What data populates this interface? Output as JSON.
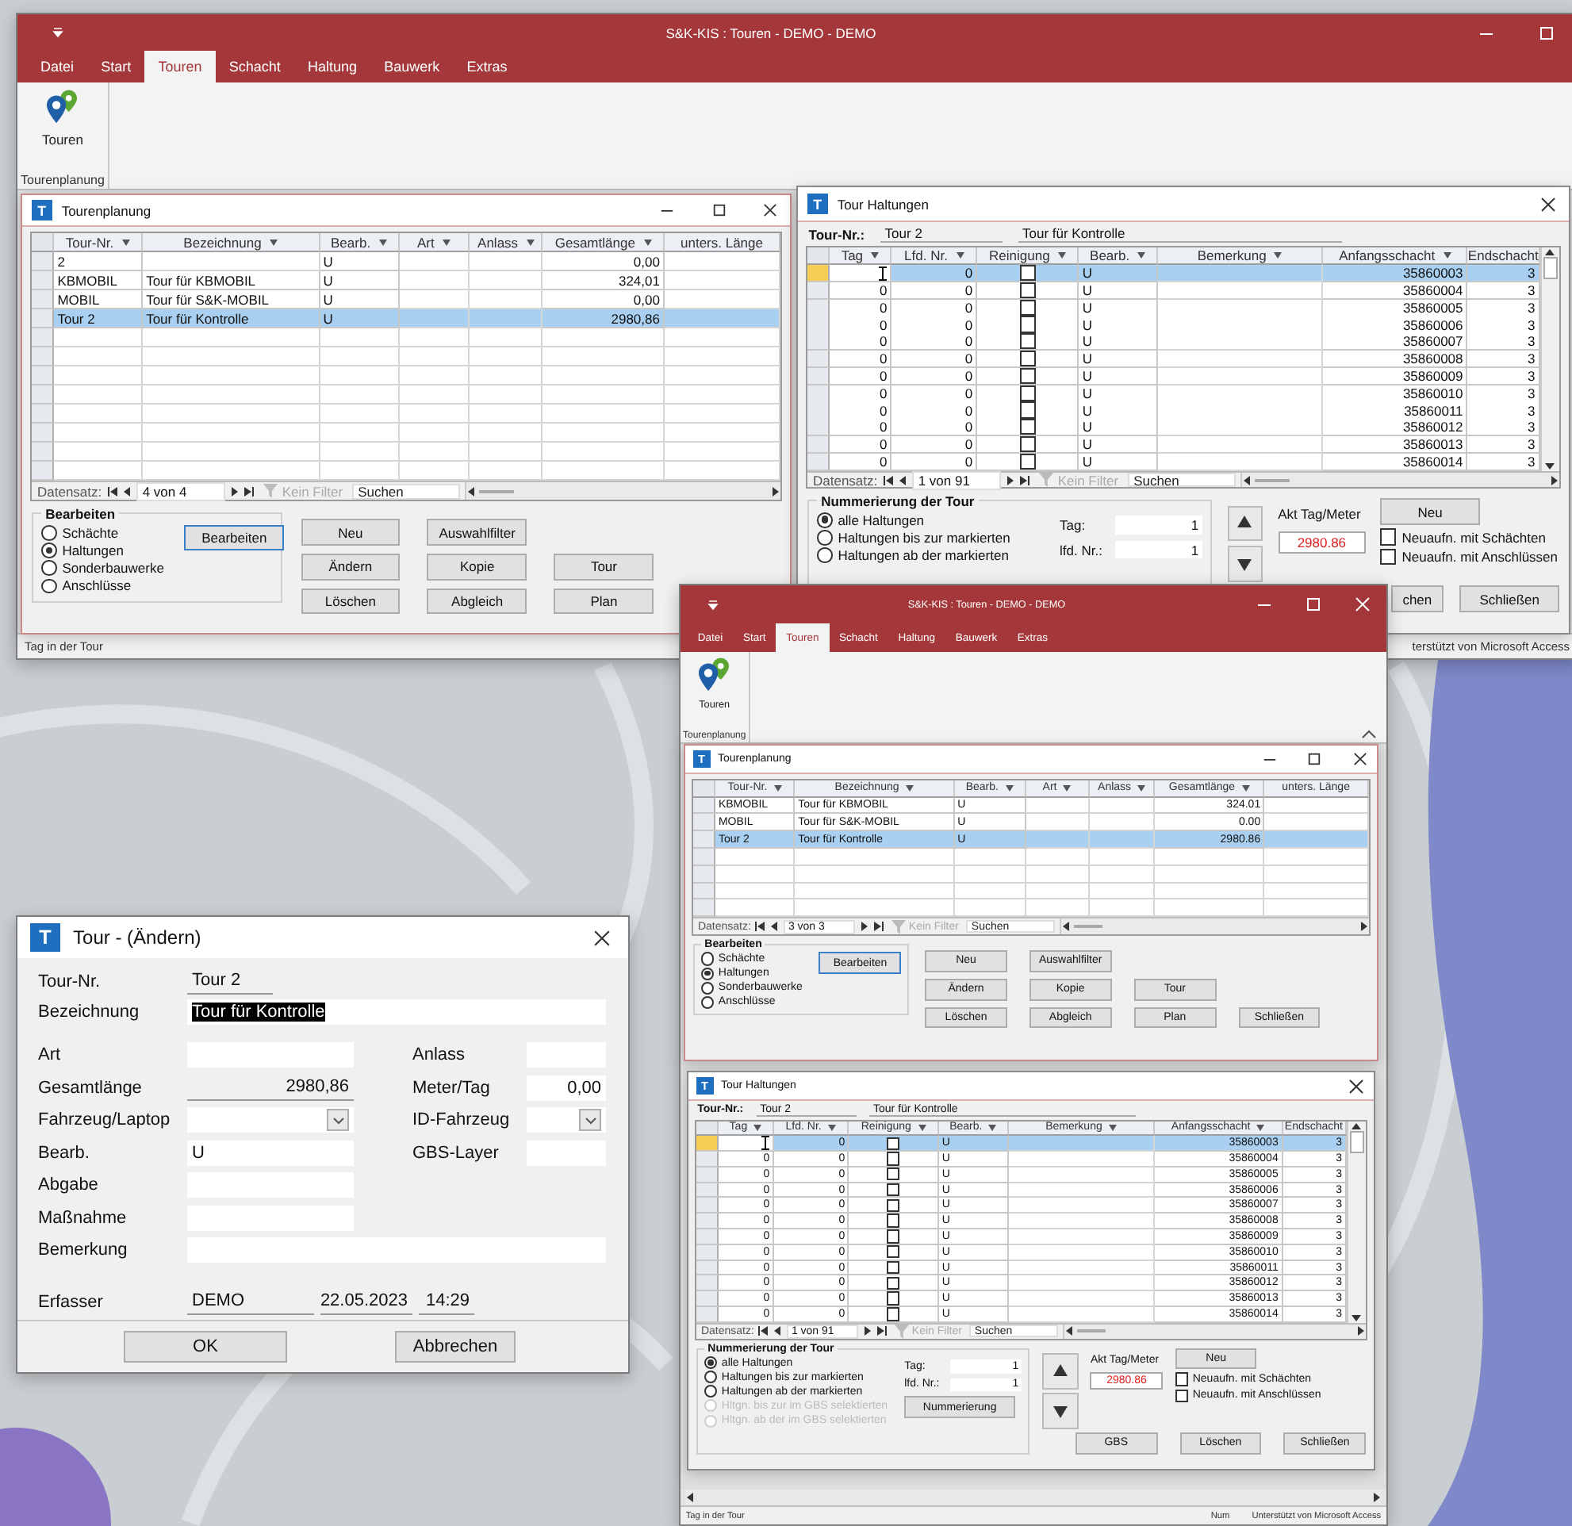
{
  "main_window": {
    "title": "S&K-KIS : Touren - DEMO - DEMO",
    "tabs": [
      {
        "label": "Datei",
        "selected": false
      },
      {
        "label": "Start",
        "selected": false
      },
      {
        "label": "Touren",
        "selected": true
      },
      {
        "label": "Schacht",
        "selected": false
      },
      {
        "label": "Haltung",
        "selected": false
      },
      {
        "label": "Bauwerk",
        "selected": false
      },
      {
        "label": "Extras",
        "selected": false
      }
    ],
    "ribbon": {
      "button": "Touren",
      "group": "Tourenplanung"
    },
    "tourenplanung": {
      "logo": "T",
      "title": "Tourenplanung",
      "columns": [
        "Tour-Nr.",
        "Bezeichnung",
        "Bearb.",
        "Art",
        "Anlass",
        "Gesamtlänge",
        "unters. Länge"
      ],
      "rows": [
        {
          "tour_nr": "2",
          "bearb": "U",
          "gesamtlaenge": "0,00",
          "selected": false
        },
        {
          "tour_nr": "KBMOBIL",
          "bezeichnung": "Tour für KBMOBIL",
          "bearb": "U",
          "gesamtlaenge": "324,01",
          "selected": false
        },
        {
          "tour_nr": "MOBIL",
          "bezeichnung": "Tour für S&K-MOBIL",
          "bearb": "U",
          "gesamtlaenge": "0,00",
          "selected": false
        },
        {
          "tour_nr": "Tour 2",
          "bezeichnung": "Tour für Kontrolle",
          "bearb": "U",
          "gesamtlaenge": "2980,86",
          "selected": true
        }
      ],
      "navigator": {
        "label": "Datensatz:",
        "position": "4 von 4",
        "filter": "Kein Filter",
        "search": {
          "placeholder": "Suchen"
        }
      },
      "group": {
        "title": "Bearbeiten",
        "options": [
          {
            "label": "Schächte",
            "selected": false
          },
          {
            "label": "Haltungen",
            "selected": true
          },
          {
            "label": "Sonderbauwerke",
            "selected": false
          },
          {
            "label": "Anschlüsse",
            "selected": false
          }
        ]
      },
      "buttons": [
        "Bearbeiten",
        "Neu",
        "Auswahlfilter",
        "Ändern",
        "Kopie",
        "Tour",
        "Löschen",
        "Abgleich",
        "Plan"
      ]
    },
    "tour_haltungen": {
      "logo": "T",
      "title": "Tour Haltungen",
      "tour_label": "Tour-Nr.:",
      "tour_nr": "Tour 2",
      "tour_name": "Tour für Kontrolle",
      "columns": [
        "Tag",
        "Lfd. Nr.",
        "Reinigung",
        "Bearb.",
        "Bemerkung",
        "Anfangsschacht",
        "Endschacht"
      ],
      "rows": [
        {
          "lfd_nr": "0",
          "reinigung": false,
          "bearb": "U",
          "anfangsschacht": "35860003",
          "endschacht": "3",
          "selected": true
        },
        {
          "tag": "0",
          "lfd_nr": "0",
          "reinigung": false,
          "bearb": "U",
          "anfangsschacht": "35860004",
          "endschacht": "3",
          "selected": false
        },
        {
          "tag": "0",
          "lfd_nr": "0",
          "reinigung": false,
          "bearb": "U",
          "anfangsschacht": "35860005",
          "endschacht": "3",
          "selected": false
        },
        {
          "tag": "0",
          "lfd_nr": "0",
          "reinigung": false,
          "bearb": "U",
          "anfangsschacht": "35860006",
          "endschacht": "3",
          "selected": false
        },
        {
          "tag": "0",
          "lfd_nr": "0",
          "reinigung": false,
          "bearb": "U",
          "anfangsschacht": "35860007",
          "endschacht": "3",
          "selected": false
        },
        {
          "tag": "0",
          "lfd_nr": "0",
          "reinigung": false,
          "bearb": "U",
          "anfangsschacht": "35860008",
          "endschacht": "3",
          "selected": false
        },
        {
          "tag": "0",
          "lfd_nr": "0",
          "reinigung": false,
          "bearb": "U",
          "anfangsschacht": "35860009",
          "endschacht": "3",
          "selected": false
        },
        {
          "tag": "0",
          "lfd_nr": "0",
          "reinigung": false,
          "bearb": "U",
          "anfangsschacht": "35860010",
          "endschacht": "3",
          "selected": false
        },
        {
          "tag": "0",
          "lfd_nr": "0",
          "reinigung": false,
          "bearb": "U",
          "anfangsschacht": "35860011",
          "endschacht": "3",
          "selected": false
        },
        {
          "tag": "0",
          "lfd_nr": "0",
          "reinigung": false,
          "bearb": "U",
          "anfangsschacht": "35860012",
          "endschacht": "3",
          "selected": false
        },
        {
          "tag": "0",
          "lfd_nr": "0",
          "reinigung": false,
          "bearb": "U",
          "anfangsschacht": "35860013",
          "endschacht": "3",
          "selected": false
        },
        {
          "tag": "0",
          "lfd_nr": "0",
          "reinigung": false,
          "bearb": "U",
          "anfangsschacht": "35860014",
          "endschacht": "3",
          "selected": false
        }
      ],
      "navigator": {
        "label": "Datensatz:",
        "position": "1 von 91",
        "filter": "Kein Filter",
        "search": {
          "placeholder": "Suchen"
        }
      },
      "numbering": {
        "title": "Nummerierung der Tour",
        "options": [
          {
            "label": "alle Haltungen",
            "selected": true,
            "disabled": false
          },
          {
            "label": "Haltungen bis zur markierten",
            "selected": false,
            "disabled": false
          },
          {
            "label": "Haltungen ab der markierten",
            "selected": false,
            "disabled": false
          }
        ]
      },
      "tag_label": "Tag:",
      "tag_value": "1",
      "lfd_label": "lfd. Nr.:",
      "lfd_value": "1",
      "meter_label": "Akt Tag/Meter",
      "meter_value": "2980.86",
      "new_button": "Neu",
      "checks": [
        {
          "label": "Neuaufn. mit Schächten",
          "checked": false
        },
        {
          "label": "Neuaufn. mit Anschlüssen",
          "checked": false
        }
      ],
      "buttons": [
        "chen",
        "Schließen"
      ]
    },
    "status_bar": {
      "left": "Tag in der Tour",
      "items": [
        "terstützt von Microsoft Access"
      ]
    }
  },
  "edit_dialog": {
    "logo": "T",
    "title": "Tour - (Ändern)",
    "rows": [
      {
        "fields": [
          {
            "label": "Tour-Nr.",
            "value": "Tour 2",
            "kind": "underline"
          }
        ]
      },
      {
        "fields": [
          {
            "label": "Bezeichnung",
            "value": "Tour für Kontrolle",
            "kind": "selected"
          }
        ]
      },
      {
        "fields": [
          {
            "label": "Art",
            "kind": "text"
          },
          {
            "label": "Anlass",
            "kind": "text"
          }
        ]
      },
      {
        "fields": [
          {
            "label": "Gesamtlänge",
            "value": "2980,86",
            "kind": "underline_number"
          },
          {
            "label": "Meter/Tag",
            "value": "0,00",
            "kind": "number"
          }
        ]
      },
      {
        "fields": [
          {
            "label": "Fahrzeug/Laptop",
            "kind": "combo"
          },
          {
            "label": "ID-Fahrzeug",
            "kind": "combo"
          }
        ]
      },
      {
        "fields": [
          {
            "label": "Bearb.",
            "value": "U",
            "kind": "text"
          },
          {
            "label": "GBS-Layer",
            "kind": "text"
          }
        ]
      },
      {
        "fields": [
          {
            "label": "Abgabe",
            "kind": "text"
          }
        ]
      },
      {
        "fields": [
          {
            "label": "Maßnahme",
            "kind": "text"
          }
        ]
      },
      {
        "fields": [
          {
            "label": "Bemerkung",
            "kind": "text"
          }
        ]
      }
    ],
    "erfasser": {
      "label": "Erfasser",
      "values": [
        "DEMO",
        "22.05.2023",
        "14:29"
      ]
    },
    "buttons": [
      "OK",
      "Abbrechen"
    ]
  },
  "second_window": {
    "title": "S&K-KIS : Touren - DEMO - DEMO",
    "tabs": [
      {
        "label": "Datei",
        "selected": false
      },
      {
        "label": "Start",
        "selected": false
      },
      {
        "label": "Touren",
        "selected": true
      },
      {
        "label": "Schacht",
        "selected": false
      },
      {
        "label": "Haltung",
        "selected": false
      },
      {
        "label": "Bauwerk",
        "selected": false
      },
      {
        "label": "Extras",
        "selected": false
      }
    ],
    "ribbon": {
      "button": "Touren",
      "group": "Tourenplanung"
    },
    "tourenplanung": {
      "logo": "T",
      "title": "Tourenplanung",
      "columns": [
        "Tour-Nr.",
        "Bezeichnung",
        "Bearb.",
        "Art",
        "Anlass",
        "Gesamtlänge",
        "unters. Länge"
      ],
      "rows": [
        {
          "tour_nr": "KBMOBIL",
          "bezeichnung": "Tour für KBMOBIL",
          "bearb": "U",
          "gesamtlaenge": "324.01",
          "selected": false
        },
        {
          "tour_nr": "MOBIL",
          "bezeichnung": "Tour für S&K-MOBIL",
          "bearb": "U",
          "gesamtlaenge": "0.00",
          "selected": false
        },
        {
          "tour_nr": "Tour 2",
          "bezeichnung": "Tour für Kontrolle",
          "bearb": "U",
          "gesamtlaenge": "2980.86",
          "selected": true
        }
      ],
      "navigator": {
        "label": "Datensatz:",
        "position": "3 von 3",
        "filter": "Kein Filter",
        "search": {
          "placeholder": "Suchen"
        }
      },
      "group": {
        "title": "Bearbeiten",
        "options": [
          {
            "label": "Schächte",
            "selected": false
          },
          {
            "label": "Haltungen",
            "selected": true
          },
          {
            "label": "Sonderbauwerke",
            "selected": false
          },
          {
            "label": "Anschlüsse",
            "selected": false
          }
        ]
      },
      "buttons": [
        "Bearbeiten",
        "Neu",
        "Auswahlfilter",
        "Ändern",
        "Kopie",
        "Tour",
        "Löschen",
        "Abgleich",
        "Plan",
        "Schließen"
      ]
    },
    "tour_haltungen": {
      "logo": "T",
      "title": "Tour Haltungen",
      "tour_label": "Tour-Nr.:",
      "tour_nr": "Tour 2",
      "tour_name": "Tour für Kontrolle",
      "columns": [
        "Tag",
        "Lfd. Nr.",
        "Reinigung",
        "Bearb.",
        "Bemerkung",
        "Anfangsschacht",
        "Endschacht"
      ],
      "rows": [
        {
          "lfd_nr": "0",
          "reinigung": false,
          "bearb": "U",
          "anfangsschacht": "35860003",
          "endschacht": "3",
          "selected": true
        },
        {
          "tag": "0",
          "lfd_nr": "0",
          "reinigung": false,
          "bearb": "U",
          "anfangsschacht": "35860004",
          "endschacht": "3",
          "selected": false
        },
        {
          "tag": "0",
          "lfd_nr": "0",
          "reinigung": false,
          "bearb": "U",
          "anfangsschacht": "35860005",
          "endschacht": "3",
          "selected": false
        },
        {
          "tag": "0",
          "lfd_nr": "0",
          "reinigung": false,
          "bearb": "U",
          "anfangsschacht": "35860006",
          "endschacht": "3",
          "selected": false
        },
        {
          "tag": "0",
          "lfd_nr": "0",
          "reinigung": false,
          "bearb": "U",
          "anfangsschacht": "35860007",
          "endschacht": "3",
          "selected": false
        },
        {
          "tag": "0",
          "lfd_nr": "0",
          "reinigung": false,
          "bearb": "U",
          "anfangsschacht": "35860008",
          "endschacht": "3",
          "selected": false
        },
        {
          "tag": "0",
          "lfd_nr": "0",
          "reinigung": false,
          "bearb": "U",
          "anfangsschacht": "35860009",
          "endschacht": "3",
          "selected": false
        },
        {
          "tag": "0",
          "lfd_nr": "0",
          "reinigung": false,
          "bearb": "U",
          "anfangsschacht": "35860010",
          "endschacht": "3",
          "selected": false
        },
        {
          "tag": "0",
          "lfd_nr": "0",
          "reinigung": false,
          "bearb": "U",
          "anfangsschacht": "35860011",
          "endschacht": "3",
          "selected": false
        },
        {
          "tag": "0",
          "lfd_nr": "0",
          "reinigung": false,
          "bearb": "U",
          "anfangsschacht": "35860012",
          "endschacht": "3",
          "selected": false
        },
        {
          "tag": "0",
          "lfd_nr": "0",
          "reinigung": false,
          "bearb": "U",
          "anfangsschacht": "35860013",
          "endschacht": "3",
          "selected": false
        },
        {
          "tag": "0",
          "lfd_nr": "0",
          "reinigung": false,
          "bearb": "U",
          "anfangsschacht": "35860014",
          "endschacht": "3",
          "selected": false
        }
      ],
      "navigator": {
        "label": "Datensatz:",
        "position": "1 von 91",
        "filter": "Kein Filter",
        "search": {
          "placeholder": "Suchen"
        }
      },
      "numbering": {
        "title": "Nummerierung der Tour",
        "options": [
          {
            "label": "alle Haltungen",
            "selected": true,
            "disabled": false
          },
          {
            "label": "Haltungen bis zur markierten",
            "selected": false,
            "disabled": false
          },
          {
            "label": "Haltungen ab der markierten",
            "selected": false,
            "disabled": false
          },
          {
            "label": "Hltgn. bis zur im GBS selektierten",
            "selected": false,
            "disabled": true
          },
          {
            "label": "Hltgn. ab der im GBS selektierten",
            "selected": false,
            "disabled": true
          }
        ]
      },
      "tag_label": "Tag:",
      "tag_value": "1",
      "lfd_label": "lfd. Nr.:",
      "lfd_value": "1",
      "number_button": "Nummerierung",
      "meter_label": "Akt Tag/Meter",
      "meter_value": "2980.86",
      "new_button": "Neu",
      "checks": [
        {
          "label": "Neuaufn. mit Schächten",
          "checked": false
        },
        {
          "label": "Neuaufn. mit Anschlüssen",
          "checked": false
        }
      ],
      "buttons": [
        "GBS",
        "Löschen",
        "Schließen"
      ]
    },
    "status_bar": {
      "left": "Tag in der Tour",
      "items": [
        "Num",
        "Unterstützt von Microsoft Access"
      ]
    }
  }
}
